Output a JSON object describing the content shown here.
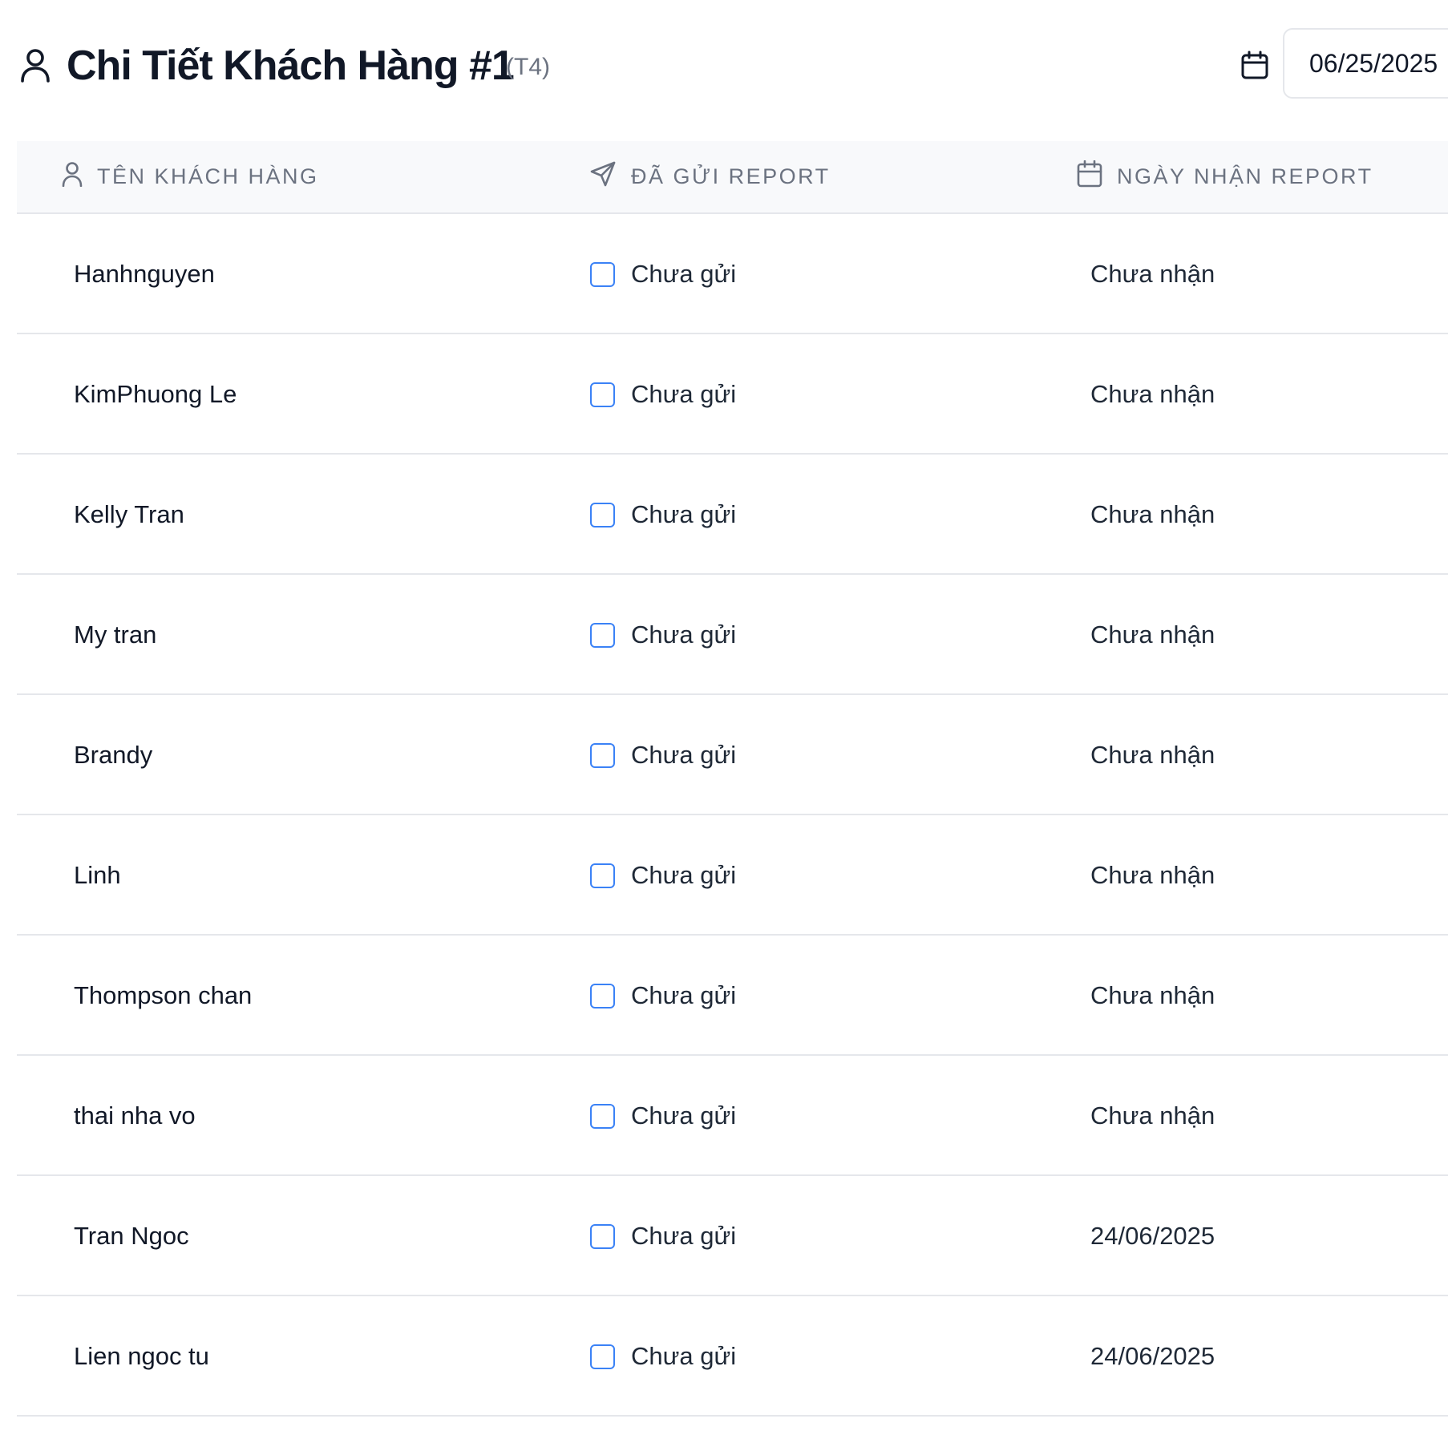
{
  "header": {
    "title": "Chi Tiết Khách Hàng #1",
    "subtitle": "(T4)",
    "date_value": "06/25/2025"
  },
  "table": {
    "columns": [
      {
        "label": "TÊN KHÁCH HÀNG",
        "icon": "user-icon"
      },
      {
        "label": "ĐÃ GỬI REPORT",
        "icon": "send-icon"
      },
      {
        "label": "NGÀY NHẬN REPORT",
        "icon": "calendar-icon"
      }
    ],
    "rows": [
      {
        "name": "Hanhnguyen",
        "sent": "Chưa gửi",
        "received": "Chưa nhận"
      },
      {
        "name": "KimPhuong Le",
        "sent": "Chưa gửi",
        "received": "Chưa nhận"
      },
      {
        "name": "Kelly Tran",
        "sent": "Chưa gửi",
        "received": "Chưa nhận"
      },
      {
        "name": "My tran",
        "sent": "Chưa gửi",
        "received": "Chưa nhận"
      },
      {
        "name": "Brandy",
        "sent": "Chưa gửi",
        "received": "Chưa nhận"
      },
      {
        "name": "Linh",
        "sent": "Chưa gửi",
        "received": "Chưa nhận"
      },
      {
        "name": "Thompson chan",
        "sent": "Chưa gửi",
        "received": "Chưa nhận"
      },
      {
        "name": "thai nha vo",
        "sent": "Chưa gửi",
        "received": "Chưa nhận"
      },
      {
        "name": "Tran Ngoc",
        "sent": "Chưa gửi",
        "received": "24/06/2025"
      },
      {
        "name": "Lien ngoc tu",
        "sent": "Chưa gửi",
        "received": "24/06/2025"
      }
    ]
  },
  "colors": {
    "checkbox_border": "#3b82f6",
    "header_bg": "#f8f9fb",
    "muted_text": "#6b7280",
    "border": "#e5e7eb"
  }
}
